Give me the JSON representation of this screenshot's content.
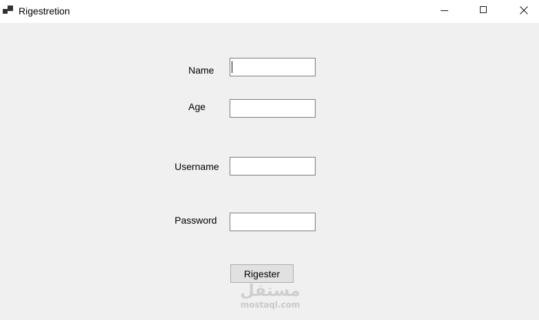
{
  "window": {
    "title": "Rigestretion",
    "controls": {
      "minimize": "minimize-icon",
      "maximize": "maximize-icon",
      "close": "close-icon"
    }
  },
  "form": {
    "fields": [
      {
        "label": "Name",
        "value": ""
      },
      {
        "label": "Age",
        "value": ""
      },
      {
        "label": "Username",
        "value": ""
      },
      {
        "label": "Password",
        "value": ""
      }
    ],
    "submit_label": "Rigester"
  },
  "watermark": {
    "arabic": "مستقل",
    "latin": "mostaql.com"
  },
  "colors": {
    "window_bg": "#f0f0f0",
    "titlebar_bg": "#ffffff",
    "button_bg": "#e1e1e1",
    "field_border": "#7a7a7a"
  }
}
